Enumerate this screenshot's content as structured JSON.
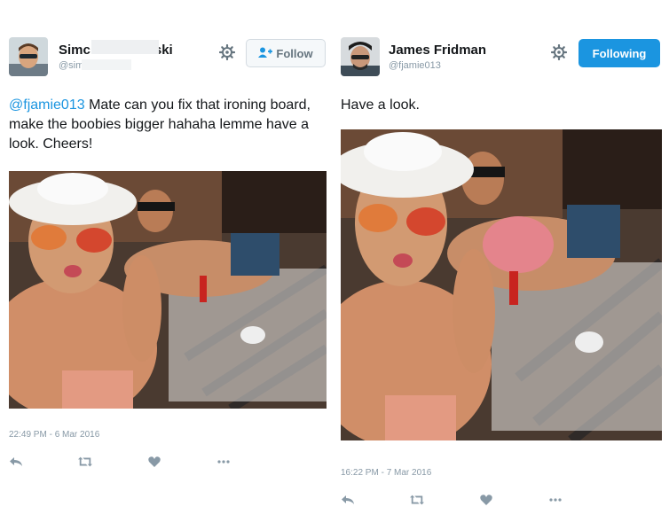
{
  "left_tweet": {
    "user": {
      "name_part1": "Simc",
      "name_part2": "ski",
      "handle": "@sim"
    },
    "follow_label": "Follow",
    "mention": "@fjamie013",
    "text": " Mate can you fix that ironing board, make the boobies bigger hahaha lemme have a look. Cheers!",
    "timestamp": "22:49 PM - 6 Mar 2016",
    "actions": [
      "reply-icon",
      "retweet-icon",
      "like-icon",
      "more-icon"
    ]
  },
  "right_tweet": {
    "user": {
      "name": "James Fridman",
      "handle": "@fjamie013"
    },
    "follow_label": "Following",
    "text": "Have a look.",
    "timestamp": "16:22 PM - 7 Mar 2016",
    "actions": [
      "reply-icon",
      "retweet-icon",
      "like-icon",
      "more-icon"
    ]
  },
  "colors": {
    "link": "#1b95e0",
    "meta": "#8899a6",
    "following_bg": "#1b95e0"
  }
}
